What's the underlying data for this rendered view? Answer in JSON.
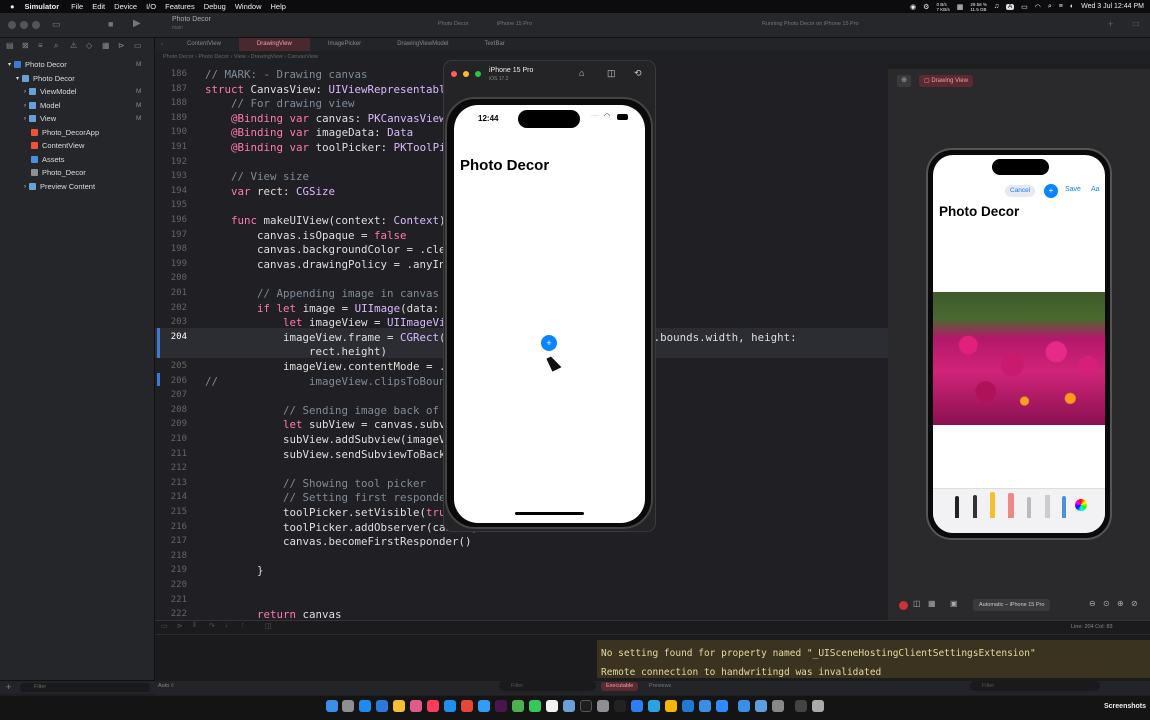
{
  "menubar": {
    "apple": "",
    "app": "Simulator",
    "items": [
      "File",
      "Edit",
      "Device",
      "I/O",
      "Features",
      "Debug",
      "Window",
      "Help"
    ],
    "net_top": "0 B/s",
    "net_bottom": "7 KB/s",
    "mem_top": "29.56 %",
    "mem_bottom": "11.5 GB",
    "input": "A",
    "clock": "Wed 3 Jul  12:44 PM"
  },
  "toolbar": {
    "project": "Photo Decor",
    "branch": "main",
    "scheme": "Photo Decor",
    "device": "iPhone 15 Pro",
    "status": "Running Photo Decor on iPhone 15 Pro"
  },
  "tabs": [
    "ContentView",
    "DrawingView",
    "ImagePicker",
    "DrawingViewModel",
    "TextBar"
  ],
  "active_tab": "DrawingView",
  "jumpbar": "Photo Decor  ›  Photo Decor  ›  View  ›  DrawingView  ›  CanvasView",
  "navigator": {
    "root": "Photo Decor",
    "group": "Photo Decor",
    "items": [
      {
        "label": "ViewModel",
        "mark": "M"
      },
      {
        "label": "Model",
        "mark": "M"
      },
      {
        "label": "View",
        "mark": "M"
      },
      {
        "label": "Photo_DecorApp",
        "mark": ""
      },
      {
        "label": "ContentView",
        "mark": ""
      },
      {
        "label": "Assets",
        "mark": ""
      },
      {
        "label": "Photo_Decor",
        "mark": ""
      },
      {
        "label": "Preview Content",
        "mark": ""
      }
    ],
    "root_mark": "M",
    "filter_placeholder": "Filter"
  },
  "editor": {
    "lines": [
      {
        "n": "186",
        "t": "// MARK: - Drawing canvas"
      },
      {
        "n": "187",
        "t": "struct CanvasView: UIViewRepresentable {"
      },
      {
        "n": "188",
        "t": "    // For drawing view"
      },
      {
        "n": "189",
        "t": "    @Binding var canvas: PKCanvasView"
      },
      {
        "n": "190",
        "t": "    @Binding var imageData: Data"
      },
      {
        "n": "191",
        "t": "    @Binding var toolPicker: PKToolPicker"
      },
      {
        "n": "192",
        "t": ""
      },
      {
        "n": "193",
        "t": "    // View size"
      },
      {
        "n": "194",
        "t": "    var rect: CGSize"
      },
      {
        "n": "195",
        "t": ""
      },
      {
        "n": "196",
        "t": "    func makeUIView(context: Context) -> PKCanvasView {"
      },
      {
        "n": "197",
        "t": "        canvas.isOpaque = false"
      },
      {
        "n": "198",
        "t": "        canvas.backgroundColor = .clear"
      },
      {
        "n": "199",
        "t": "        canvas.drawingPolicy = .anyInput"
      },
      {
        "n": "200",
        "t": ""
      },
      {
        "n": "201",
        "t": "        // Appending image in canvas"
      },
      {
        "n": "202",
        "t": "        if let image = UIImage(data: imageData) {"
      },
      {
        "n": "203",
        "t": "            let imageView = UIImageView(image: image)"
      },
      {
        "n": "204",
        "t": "            imageView.frame = CGRect(x: 0, y: 0, width: UIScreen.main.bounds.width, height:"
      },
      {
        "n": "",
        "t": "                rect.height)"
      },
      {
        "n": "205",
        "t": "            imageView.contentMode = .scaleAspectFit"
      },
      {
        "n": "206",
        "t": "//              imageView.clipsToBounds = true"
      },
      {
        "n": "207",
        "t": ""
      },
      {
        "n": "208",
        "t": "            // Sending image back of canvas"
      },
      {
        "n": "209",
        "t": "            let subView = canvas.subviews[0]"
      },
      {
        "n": "210",
        "t": "            subView.addSubview(imageView)"
      },
      {
        "n": "211",
        "t": "            subView.sendSubviewToBack(imageView)"
      },
      {
        "n": "212",
        "t": ""
      },
      {
        "n": "213",
        "t": "            // Showing tool picker"
      },
      {
        "n": "214",
        "t": "            // Setting first responder"
      },
      {
        "n": "215",
        "t": "            toolPicker.setVisible(true, forFirstResponder: canvas)"
      },
      {
        "n": "216",
        "t": "            toolPicker.addObserver(canvas)"
      },
      {
        "n": "217",
        "t": "            canvas.becomeFirstResponder()"
      },
      {
        "n": "218",
        "t": ""
      },
      {
        "n": "219",
        "t": "        }"
      },
      {
        "n": "220",
        "t": ""
      },
      {
        "n": "221",
        "t": ""
      },
      {
        "n": "222",
        "t": "        return canvas"
      }
    ]
  },
  "simulator": {
    "title": "iPhone 15 Pro",
    "subtitle": "iOS 17.2",
    "time": "12:44",
    "app_title": "Photo Decor",
    "plus": "+"
  },
  "preview": {
    "pin_label": "Drawing View",
    "cancel": "Cancel",
    "plus": "+",
    "save": "Save",
    "aa": "Aa",
    "title": "Photo Decor",
    "device_label": "Automatic – iPhone 15 Pro"
  },
  "status": {
    "line_col": "Line: 204  Col: 83",
    "auto": "Auto ◊",
    "filter": "Filter",
    "executable": "Executable",
    "previews": "Previews",
    "console_filter": "Filter"
  },
  "console": {
    "lines": [
      "No setting found for property named \"_UISceneHostingClientSettingsExtension\"",
      "Remote connection to handwritingd was invalidated"
    ]
  },
  "dock_label": "Screenshots",
  "colors": {
    "accent": "#0a84ff",
    "tab_active": "#f0a0a8",
    "console_bg": "#3a3320"
  }
}
